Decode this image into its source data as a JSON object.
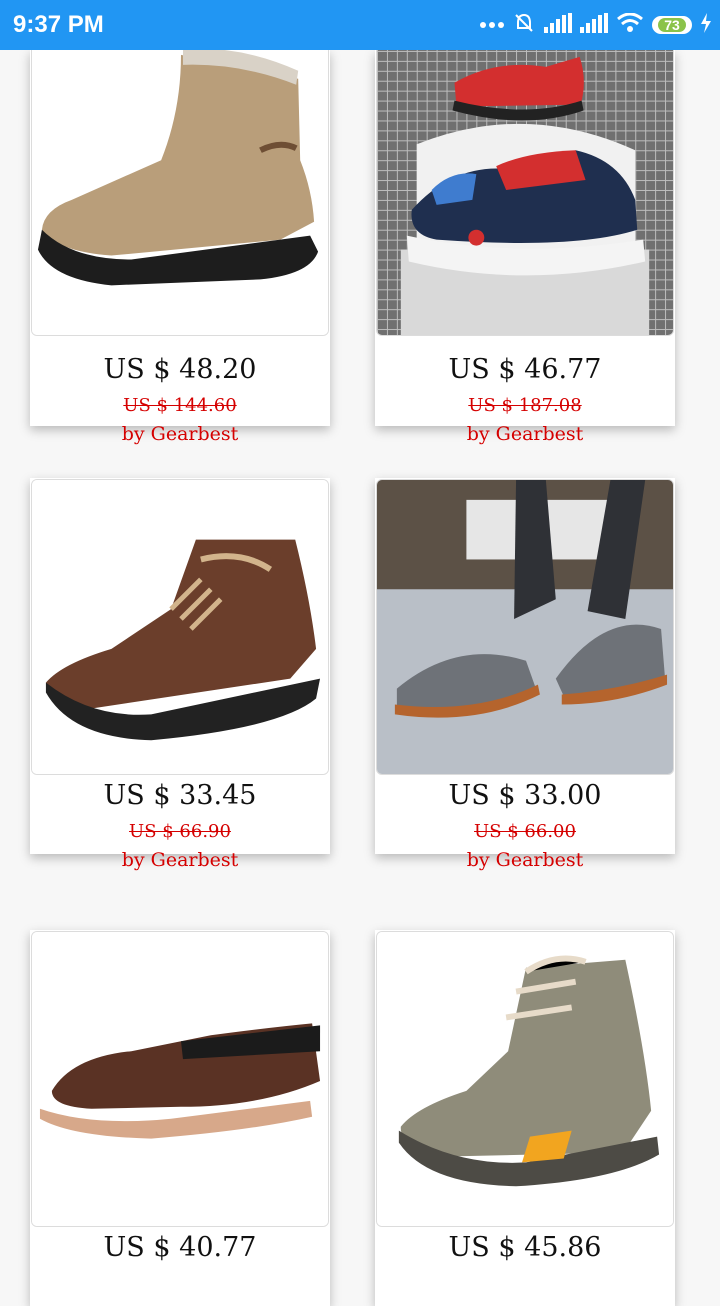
{
  "status_bar": {
    "time": "9:37 PM",
    "battery": "73",
    "icons": [
      "more-icon",
      "alarm-off-icon",
      "signal-icon",
      "signal-icon",
      "wifi-icon",
      "battery-icon",
      "charging-icon"
    ]
  },
  "products": [
    {
      "price": "US $ 48.20",
      "old_price": "US $ 144.60",
      "seller": "by Gearbest",
      "image": "tan-suede-boot"
    },
    {
      "price": "US $ 46.77",
      "old_price": "US $ 187.08",
      "seller": "by Gearbest",
      "image": "red-blue-sneakers"
    },
    {
      "price": "US $ 33.45",
      "old_price": "US $ 66.90",
      "seller": "by Gearbest",
      "image": "brown-leather-boot"
    },
    {
      "price": "US $ 33.00",
      "old_price": "US $ 66.00",
      "seller": "by Gearbest",
      "image": "gray-suede-oxfords"
    },
    {
      "price": "US $ 40.77",
      "old_price": "",
      "seller": "",
      "image": "brown-loafer"
    },
    {
      "price": "US $ 45.86",
      "old_price": "",
      "seller": "",
      "image": "gray-hiking-boot"
    }
  ],
  "colors": {
    "status_bar": "#2196f3",
    "sale_red": "#d50000"
  }
}
